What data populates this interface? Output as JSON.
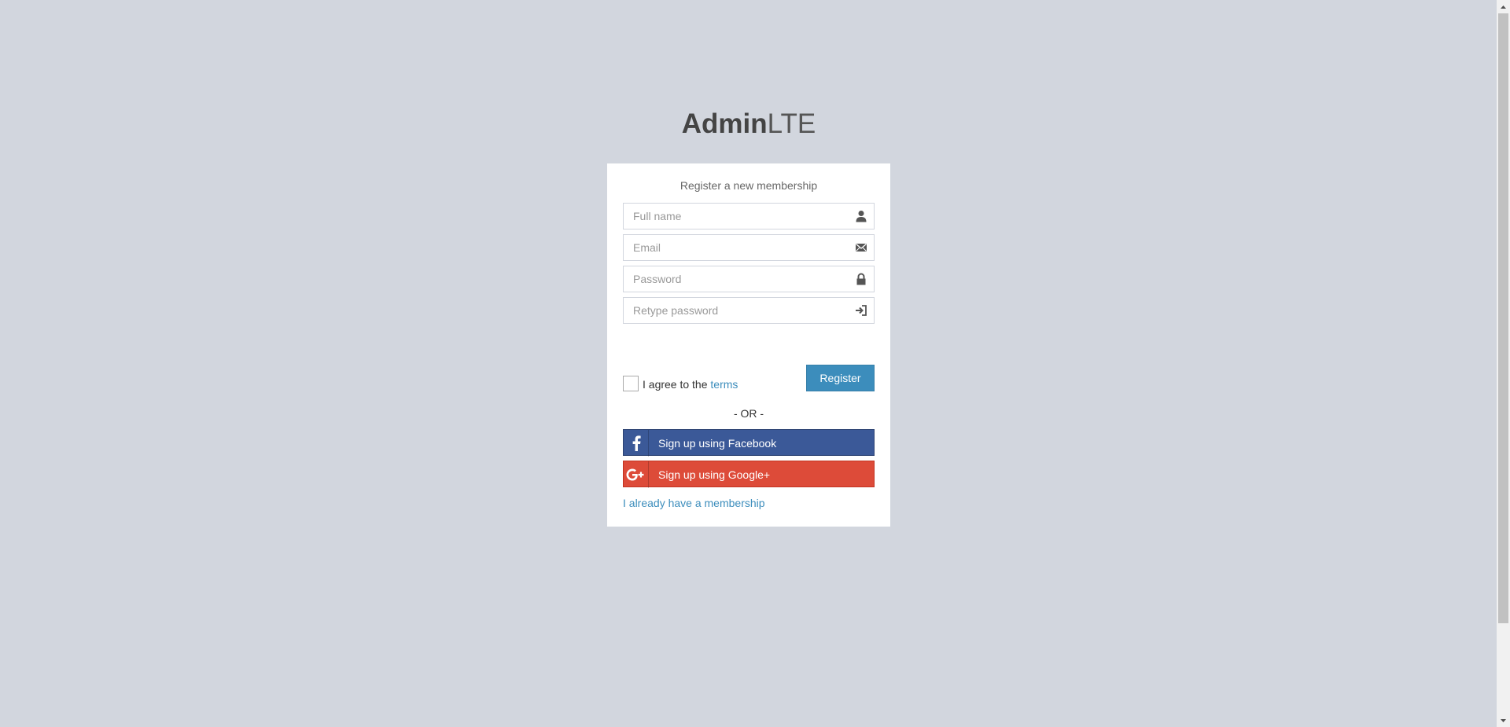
{
  "logo": {
    "bold": "Admin",
    "light": "LTE"
  },
  "register_box": {
    "message": "Register a new membership",
    "fields": [
      {
        "placeholder": "Full name",
        "icon": "user-icon"
      },
      {
        "placeholder": "Email",
        "icon": "envelope-icon"
      },
      {
        "placeholder": "Password",
        "icon": "lock-icon"
      },
      {
        "placeholder": "Retype password",
        "icon": "log-in-icon"
      }
    ],
    "agree_prefix": "I agree to the ",
    "terms_link": "terms",
    "register_button": "Register",
    "separator": "- OR -",
    "social": {
      "facebook_label": "Sign up using Facebook",
      "google_label": "Sign up using Google+"
    },
    "login_link": "I already have a membership"
  },
  "colors": {
    "background": "#d2d6de",
    "primary": "#3c8dbc",
    "facebook": "#3b5998",
    "google": "#dd4b39"
  }
}
